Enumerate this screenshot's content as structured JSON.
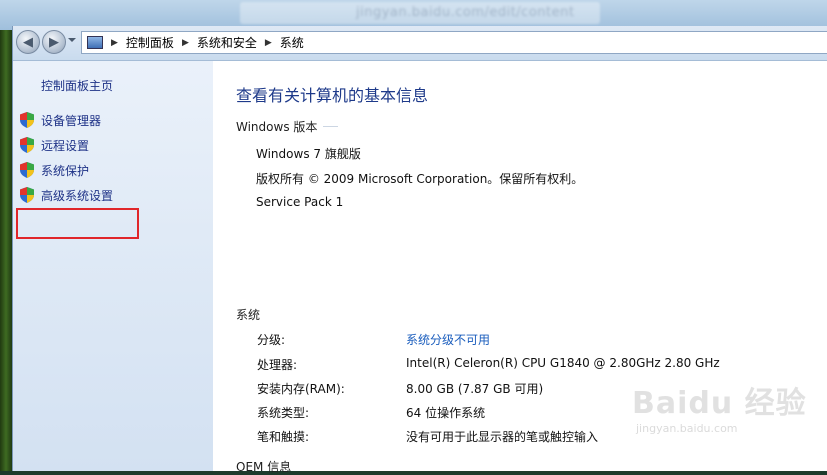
{
  "browser_bg": {
    "url_text": "jingyan.baidu.com/edit/content"
  },
  "address_bar": {
    "crumbs": [
      "控制面板",
      "系统和安全",
      "系统"
    ]
  },
  "sidebar": {
    "home_label": "控制面板主页",
    "items": [
      {
        "label": "设备管理器",
        "icon": "shield-icon"
      },
      {
        "label": "远程设置",
        "icon": "shield-icon"
      },
      {
        "label": "系统保护",
        "icon": "shield-icon"
      },
      {
        "label": "高级系统设置",
        "icon": "shield-icon"
      }
    ],
    "highlight_color": "#e0262a"
  },
  "main": {
    "title": "查看有关计算机的基本信息",
    "windows_section": {
      "heading": "Windows 版本",
      "lines": [
        "Windows 7 旗舰版",
        "版权所有 © 2009 Microsoft Corporation。保留所有权利。",
        "Service Pack 1"
      ]
    },
    "system_section": {
      "heading": "系统",
      "rows": [
        {
          "label": "分级:",
          "value": "系统分级不可用"
        },
        {
          "label": "处理器:",
          "value": "Intel(R) Celeron(R) CPU G1840 @ 2.80GHz   2.80 GHz"
        },
        {
          "label": "安装内存(RAM):",
          "value": "8.00 GB (7.87 GB 可用)"
        },
        {
          "label": "系统类型:",
          "value": "64 位操作系统"
        },
        {
          "label": "笔和触摸:",
          "value": "没有可用于此显示器的笔或触控输入"
        }
      ]
    },
    "oem_heading": "OEM 信息"
  },
  "watermark": {
    "logo": "Baidu 经验",
    "url": "jingyan.baidu.com"
  },
  "colors": {
    "link": "#1a5dbd",
    "title": "#1e3a8a",
    "sidebar_link": "#1e3287"
  }
}
